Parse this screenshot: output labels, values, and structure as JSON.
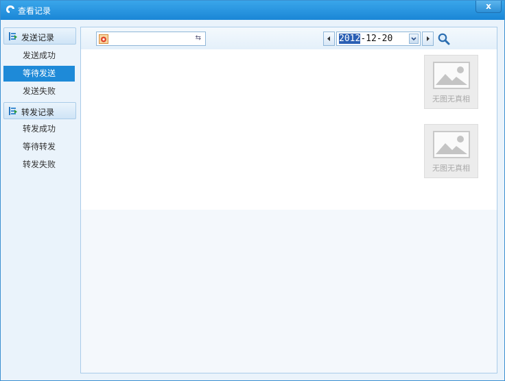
{
  "window": {
    "title": "查看记录",
    "close_label": "x"
  },
  "sidebar": {
    "groups": [
      {
        "label": "发送记录",
        "items": [
          {
            "label": "发送成功"
          },
          {
            "label": "等待发送",
            "selected": true
          },
          {
            "label": "发送失败"
          }
        ]
      },
      {
        "label": "转发记录",
        "items": [
          {
            "label": "转发成功"
          },
          {
            "label": "等待转发"
          },
          {
            "label": "转发失败"
          }
        ]
      }
    ]
  },
  "toolbar": {
    "contact_value": "",
    "date": {
      "selected_part": "2012",
      "rest": "-12-20"
    }
  },
  "cards": [
    {
      "caption": "无图无真相"
    },
    {
      "caption": "无图无真相"
    }
  ],
  "colors": {
    "titlebar": "#1a86d6",
    "selected": "#1e8ad8",
    "border": "#a9cbe8"
  }
}
